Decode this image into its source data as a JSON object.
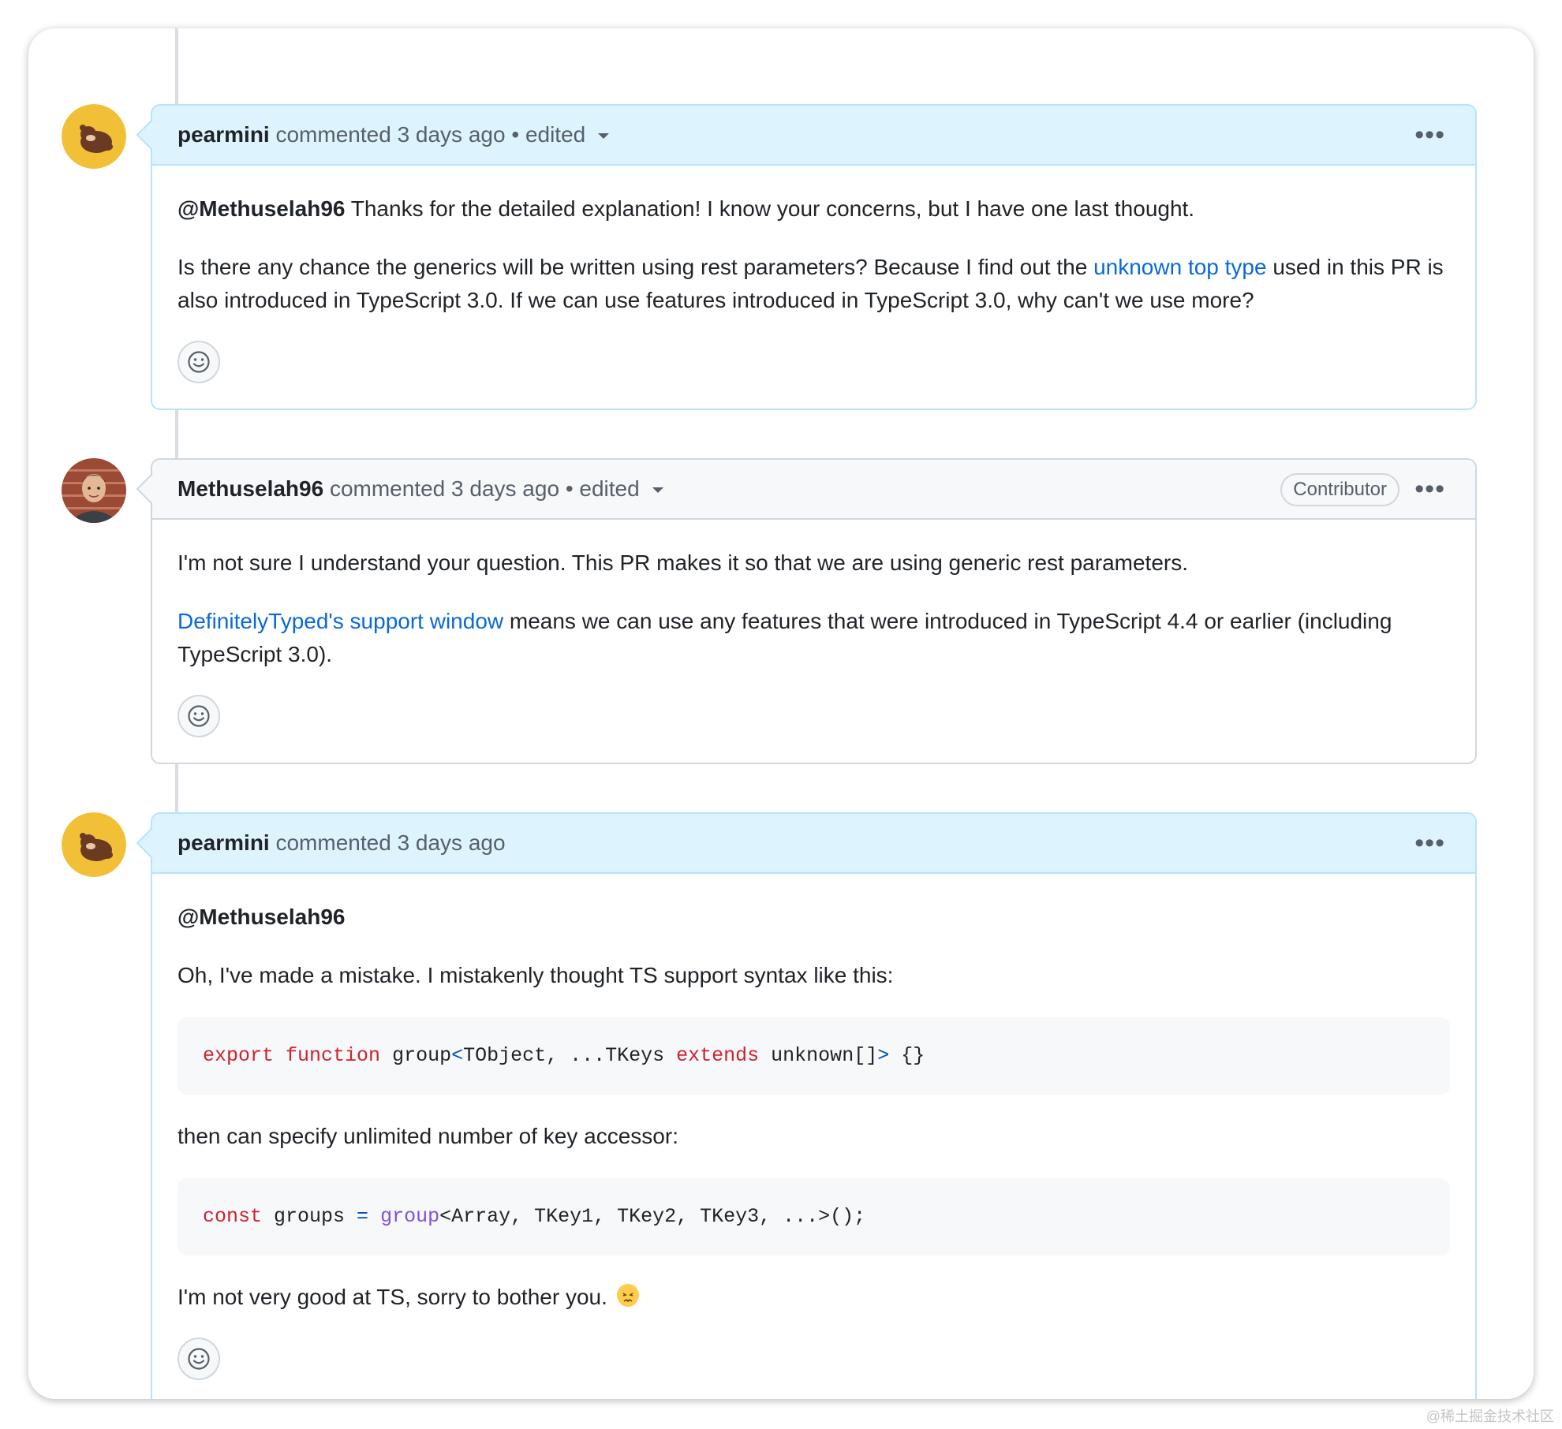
{
  "comments": [
    {
      "author": "pearmini",
      "action": "commented",
      "time": "3 days ago",
      "edited_marker": "•",
      "edited_label": "edited",
      "menu_label": "•••",
      "mention": "@Methuselah96",
      "text_1": " Thanks for the detailed explanation! I know your concerns, but I have one last thought.",
      "text_2_before": "Is there any chance the generics will be written using rest parameters? Because I find out the ",
      "link": "unknown top type",
      "text_2_after": " used in this PR is also introduced in TypeScript 3.0. If we can use features introduced in TypeScript 3.0, why can't we use more?"
    },
    {
      "author": "Methuselah96",
      "action": "commented",
      "time": "3 days ago",
      "edited_marker": "•",
      "edited_label": "edited",
      "badge": "Contributor",
      "menu_label": "•••",
      "text_1": "I'm not sure I understand your question. This PR makes it so that we are using generic rest parameters.",
      "link": "DefinitelyTyped's support window",
      "text_2_after": " means we can use any features that were introduced in TypeScript 4.4 or earlier (including TypeScript 3.0)."
    },
    {
      "author": "pearmini",
      "action": "commented",
      "time": "3 days ago",
      "menu_label": "•••",
      "mention": "@Methuselah96",
      "text_1": "Oh, I've made a mistake. I mistakenly thought TS support syntax like this:",
      "code_1": {
        "kw1": "export",
        "kw2": "function",
        "t1": " group",
        "op1": "<",
        "t2": "TObject, ...TKeys ",
        "kw3": "extends",
        "t3": " unknown[]",
        "op2": ">",
        "t4": " {}"
      },
      "text_2": "then can specify unlimited number of key accessor:",
      "code_2": {
        "kw1": "const",
        "t1": " groups ",
        "op1": "=",
        "fn1": "group",
        "t2": "<Array, TKey1, TKey2, TKey3, ...>();"
      },
      "text_3": "I'm not very good at TS, sorry to bother you."
    }
  ],
  "watermark": "@稀土掘金技术社区",
  "colors": {
    "own_header": "#ddf4ff",
    "other_header": "#f6f8fa",
    "link": "#0969da",
    "keyword": "#cf222e",
    "function": "#8250df"
  }
}
